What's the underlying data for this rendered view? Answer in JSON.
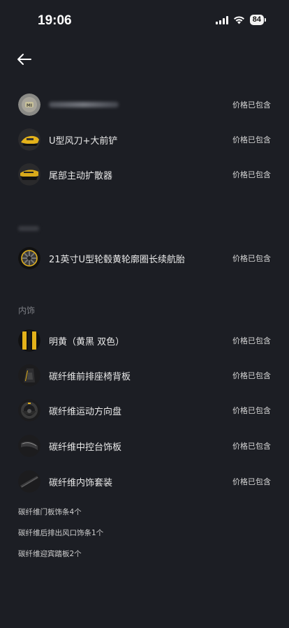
{
  "status": {
    "time": "19:06",
    "battery": "84",
    "icons": [
      "signal-icon",
      "wifi-icon",
      "battery-icon"
    ]
  },
  "nav": {
    "back_icon": "back-arrow-icon"
  },
  "sections": {
    "interior_title": "内饰"
  },
  "exterior_items": [
    {
      "label": "",
      "price": "价格已包含",
      "icon": "wheel-logo-thumb"
    },
    {
      "label": "U型风刀+大前铲",
      "price": "价格已包含",
      "icon": "front-splitter-thumb"
    },
    {
      "label": "尾部主动扩散器",
      "price": "价格已包含",
      "icon": "rear-diffuser-thumb"
    }
  ],
  "wheel_items": [
    {
      "label": "21英寸U型轮毂黄轮廓圈长续航胎",
      "price": "价格已包含",
      "icon": "wheel-thumb"
    }
  ],
  "interior_items": [
    {
      "label": "明黄（黄黑 双色）",
      "price": "价格已包含",
      "icon": "interior-color-thumb"
    },
    {
      "label": "碳纤维前排座椅背板",
      "price": "价格已包含",
      "icon": "seat-back-thumb"
    },
    {
      "label": "碳纤维运动方向盘",
      "price": "价格已包含",
      "icon": "steering-wheel-thumb"
    },
    {
      "label": "碳纤维中控台饰板",
      "price": "价格已包含",
      "icon": "console-trim-thumb"
    },
    {
      "label": "碳纤维内饰套装",
      "price": "价格已包含",
      "icon": "interior-kit-thumb"
    }
  ],
  "kit_notes": [
    "碳纤维门板饰条4个",
    "碳纤维后排出风口饰条1个",
    "碳纤维迎宾踏板2个"
  ],
  "colors": {
    "background": "#1c1e24",
    "accent_yellow": "#e4b21a"
  }
}
